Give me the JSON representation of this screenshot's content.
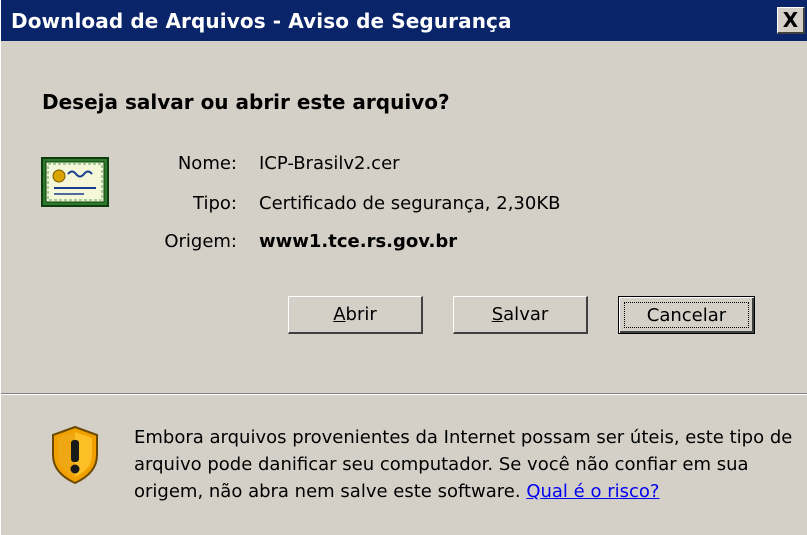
{
  "window": {
    "title": "Download de Arquivos - Aviso de Segurança",
    "close_label": "X"
  },
  "dialog": {
    "question": "Deseja salvar ou abrir este arquivo?",
    "file": {
      "name_label": "Nome:",
      "name_value": "ICP-Brasilv2.cer",
      "type_label": "Tipo:",
      "type_value": "Certificado de segurança, 2,30KB",
      "origin_label": "Origem:",
      "origin_value": "www1.tce.rs.gov.br",
      "icon": "certificate-icon"
    },
    "buttons": {
      "open_mnemonic": "A",
      "open_rest": "brir",
      "save_mnemonic": "S",
      "save_rest": "alvar",
      "cancel_label": "Cancelar"
    }
  },
  "warning": {
    "icon": "shield-warning-icon",
    "text": "Embora arquivos provenientes da Internet possam ser úteis, este tipo de arquivo pode danificar seu computador. Se você não confiar em sua origem, não abra nem salve este software. ",
    "link_label": "Qual é o risco?"
  },
  "colors": {
    "titlebar": "#0a246a",
    "dialog_bg": "#d4d0c8",
    "link": "#0000ee"
  }
}
